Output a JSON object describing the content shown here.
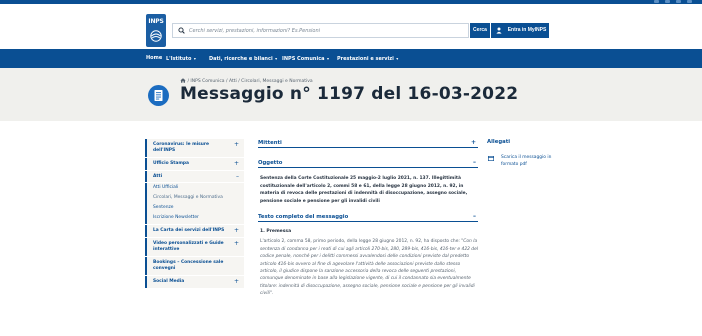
{
  "header": {
    "logo_text": "INPS",
    "search_placeholder": "Cerchi servizi, prestazioni, informazioni? Es.Pensioni",
    "search_button": "Cerca",
    "mypage_button": "Entra in MyINPS"
  },
  "nav": {
    "items": [
      {
        "label": "Home",
        "has_menu": false
      },
      {
        "label": "L'Istituto",
        "has_menu": true
      },
      {
        "label": "Dati, ricerche e bilanci",
        "has_menu": true
      },
      {
        "label": "INPS Comunica",
        "has_menu": true
      },
      {
        "label": "Prestazioni e servizi",
        "has_menu": true
      }
    ]
  },
  "breadcrumb": {
    "items": [
      "INPS Comunica",
      "Atti",
      "Circolari, Messaggi e Normativa"
    ],
    "separator": "/"
  },
  "page": {
    "title": "Messaggio n° 1197 del 16-03-2022"
  },
  "sidebar": {
    "items": [
      {
        "label": "Coronavirus: le misure dell'INPS",
        "toggle": "+"
      },
      {
        "label": "Ufficio Stampa",
        "toggle": "+"
      },
      {
        "label": "Atti",
        "toggle": "–"
      },
      {
        "label": "La Carta dei servizi dell'INPS",
        "toggle": "+"
      },
      {
        "label": "Video personalizzati e Guide interattive",
        "toggle": "+"
      },
      {
        "label": "Bookings – Concessione sale convegni",
        "toggle": ""
      },
      {
        "label": "Social Media",
        "toggle": "+"
      }
    ],
    "atti_children": [
      "Atti Ufficiali",
      "Circolari, Messaggi e Normativa",
      "Sentenze",
      "Iscrizione Newsletter"
    ]
  },
  "content": {
    "mittenti": {
      "title": "Mittenti",
      "toggle": "+"
    },
    "oggetto": {
      "title": "Oggetto",
      "toggle": "–",
      "text": "Sentenza della Corte Costituzionale 25 maggio-2 luglio 2021, n. 137. Illegittimità costituzionale dell'articolo 2, commi 58 e 61, della legge 28 giugno 2012, n. 92, in materia di revoca delle prestazioni di indennità di disoccupazione, assegno sociale, pensione sociale e pensione per gli invalidi civili"
    },
    "testo": {
      "title": "Testo completo del messaggio",
      "toggle": "–",
      "premessa_title": "1. Premessa",
      "paragraph_intro": "L'articolo 2, comma 58, primo periodo, della legge 28 giugno 2012, n. 92, ha disposto che: ",
      "paragraph_quote": "\"Con la sentenza di condanna per i reati di cui agli articoli 270-bis, 280, 289-bis, 416-bis, 416-ter e 422 del codice penale, nonché per i delitti commessi avvalendosi delle condizioni previste dal predetto articolo 416-bis ovvero al fine di agevolare l'attività delle associazioni previste dallo stesso articolo, il giudice dispone la sanzione accessoria della revoca delle seguenti prestazioni, comunque denominate in base alla legislazione vigente, di cui il condannato sia eventualmente titolare: indennità di disoccupazione, assegno sociale, pensione sociale e pensione per gli invalidi civili\"."
    }
  },
  "aside": {
    "title": "Allegati",
    "attachment": "Scarica il messaggio in formato pdf"
  },
  "colors": {
    "brand_blue": "#0a4f93",
    "hero_bg": "#f0f0ed"
  }
}
